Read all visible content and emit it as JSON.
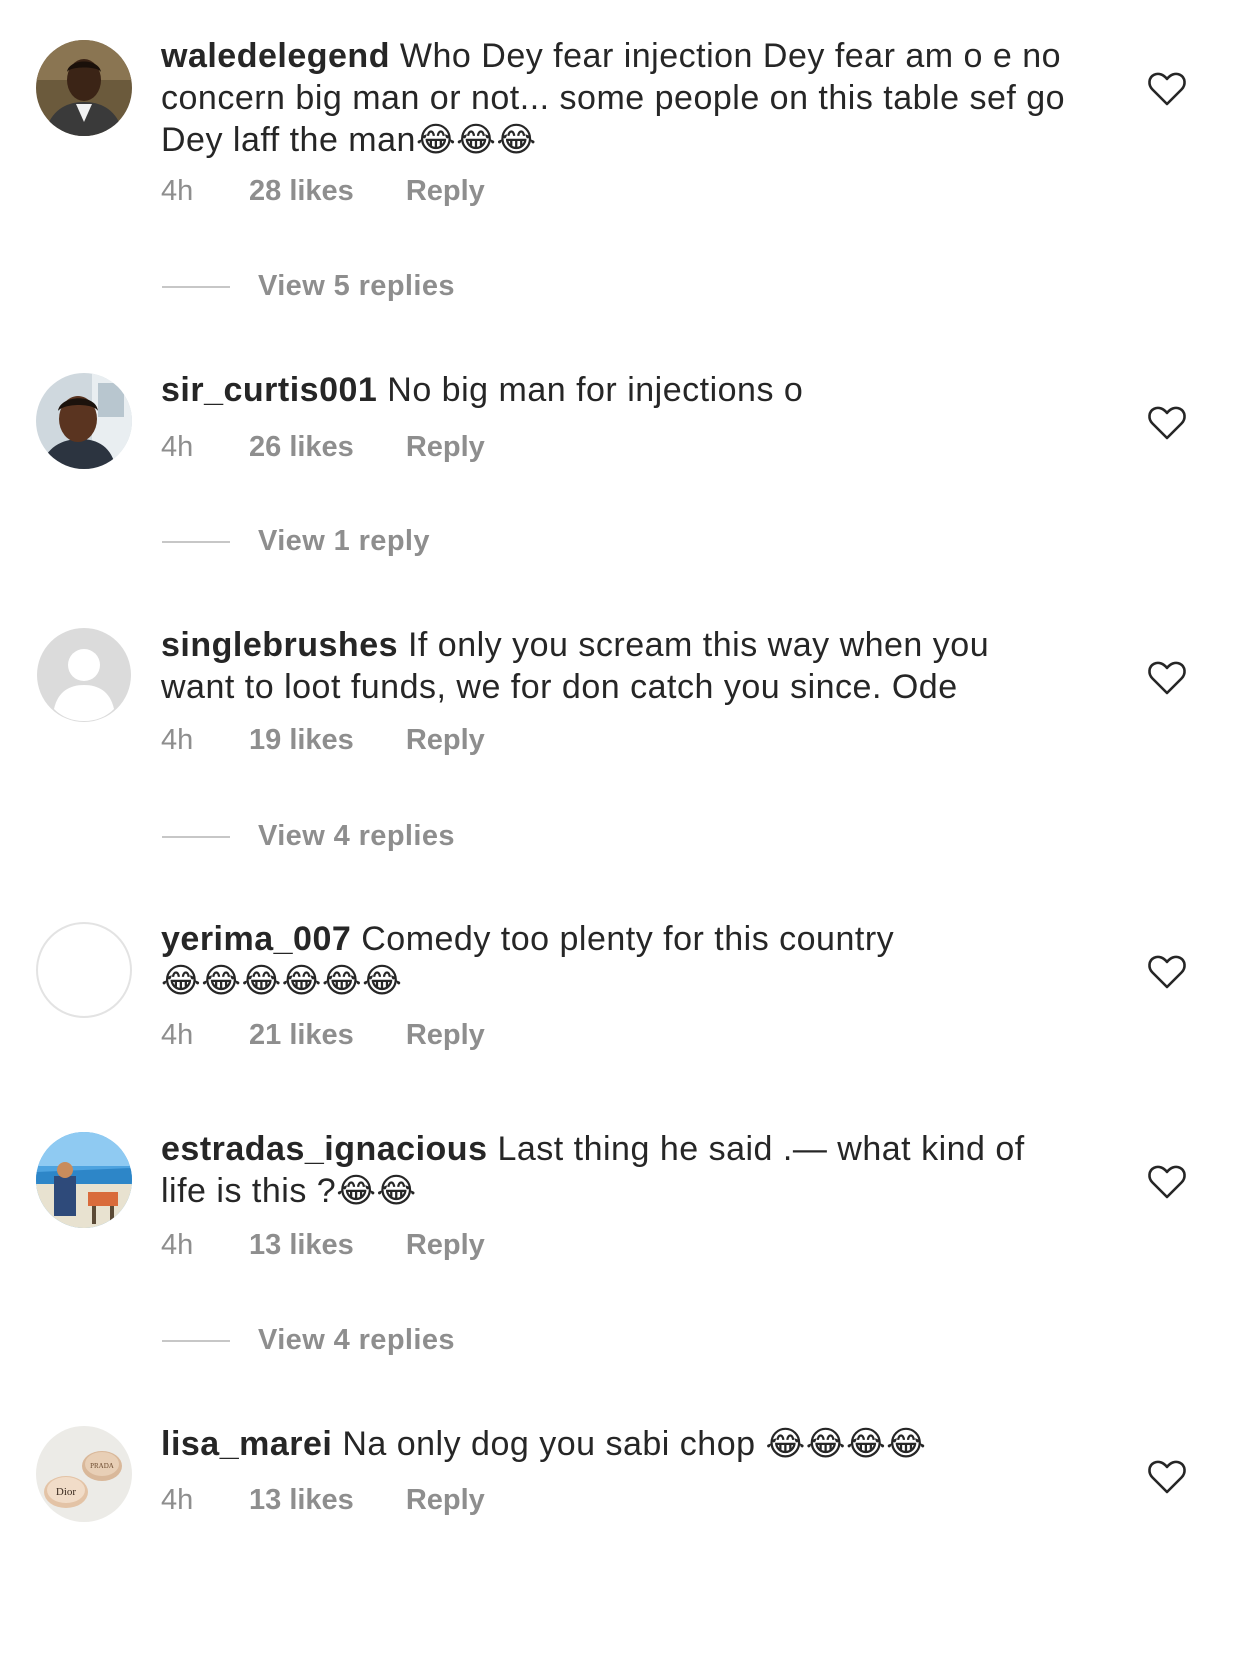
{
  "comments": [
    {
      "username": "waledelegend",
      "text": "Who Dey fear injection Dey fear am o e no concern big man or not... some people on this table sef go Dey laff the man",
      "emojis": "😂😂😂",
      "time": "4h",
      "likes": "28 likes",
      "reply_label": "Reply",
      "view_replies": "View 5 replies",
      "avatar_icon": "profile-photo",
      "heart_icon": "heart-outline-icon"
    },
    {
      "username": "sir_curtis001",
      "text": "No big  man for injections o",
      "emojis": "",
      "time": "4h",
      "likes": "26 likes",
      "reply_label": "Reply",
      "view_replies": "View 1 reply",
      "avatar_icon": "profile-photo",
      "heart_icon": "heart-outline-icon"
    },
    {
      "username": "singlebrushes",
      "text": "If only you scream this way when you want to loot funds, we for don catch you since. Ode",
      "emojis": "",
      "time": "4h",
      "likes": "19 likes",
      "reply_label": "Reply",
      "view_replies": "View 4 replies",
      "avatar_icon": "default-avatar-icon",
      "heart_icon": "heart-outline-icon"
    },
    {
      "username": "yerima_007",
      "text": "Comedy too plenty for this country",
      "emojis": "😂😂😂😂😂😂",
      "time": "4h",
      "likes": "21 likes",
      "reply_label": "Reply",
      "view_replies": "",
      "avatar_icon": "blank-avatar",
      "heart_icon": "heart-outline-icon"
    },
    {
      "username": "estradas_ignacious",
      "text": "Last thing he said .— what kind of life is this ?",
      "emojis": "😂😂",
      "time": "4h",
      "likes": "13 likes",
      "reply_label": "Reply",
      "view_replies": "View 4 replies",
      "avatar_icon": "profile-photo",
      "heart_icon": "heart-outline-icon"
    },
    {
      "username": "lisa_marei",
      "text": "Na only dog you sabi chop",
      "emojis": "😂😂😂😂",
      "time": "4h",
      "likes": "13 likes",
      "reply_label": "Reply",
      "view_replies": "",
      "avatar_icon": "profile-photo",
      "heart_icon": "heart-outline-icon",
      "avatar_logo_texts": [
        "PRADA",
        "Dior"
      ]
    }
  ]
}
